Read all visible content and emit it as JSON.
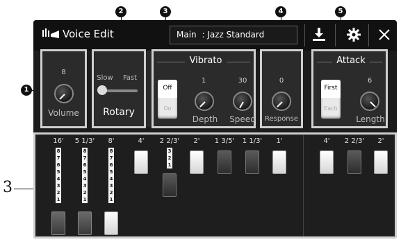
{
  "header": {
    "title": "Voice Edit",
    "voice_part": "Main",
    "voice_name": ": Jazz Standard"
  },
  "callouts": [
    "1",
    "2",
    "3",
    "4",
    "5"
  ],
  "side_label": "3",
  "volume": {
    "label": "Volume",
    "value": "8"
  },
  "rotary": {
    "label": "Rotary",
    "slow": "Slow",
    "fast": "Fast"
  },
  "vibrato": {
    "title": "Vibrato",
    "toggle_on": "Off",
    "toggle_off": "On",
    "depth_label": "Depth",
    "depth_value": "1",
    "speed_label": "Speed",
    "speed_value": "30"
  },
  "response": {
    "label": "Response",
    "value": "0"
  },
  "attack": {
    "title": "Attack",
    "toggle_on": "First",
    "toggle_off": "Each",
    "length_label": "Length",
    "length_value": "6"
  },
  "drawbars": {
    "footages": [
      "16'",
      "5 1/3'",
      "8'",
      "4'",
      "2 2/3'",
      "2'",
      "1 3/5'",
      "1 1/3'",
      "1'",
      "4'",
      "2 2/3'",
      "2'"
    ],
    "scale_full": "87654321",
    "scale_short": "321",
    "levels": [
      8,
      8,
      8,
      0,
      3,
      0,
      0,
      0,
      0,
      0,
      0,
      0
    ]
  },
  "colors": {
    "screen_bg": "#1c1c1c",
    "panel_border": "#cfcfcf",
    "callout": "#111111"
  }
}
